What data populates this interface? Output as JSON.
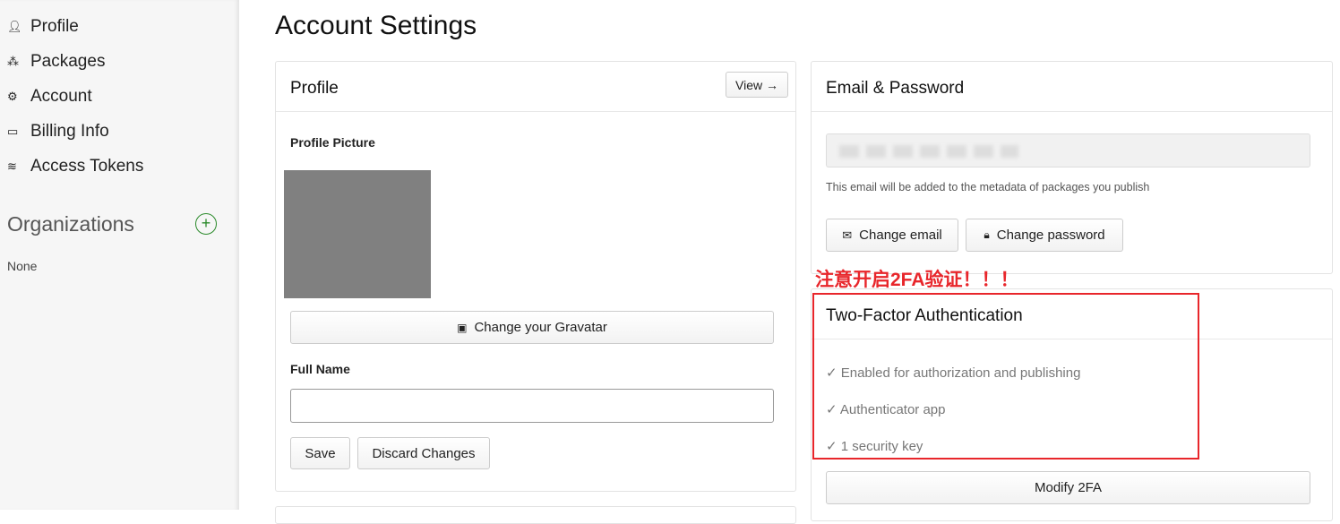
{
  "sidebar": {
    "items": [
      {
        "label": "Profile",
        "icon": "user-icon"
      },
      {
        "label": "Packages",
        "icon": "packages-icon"
      },
      {
        "label": "Account",
        "icon": "gear-icon"
      },
      {
        "label": "Billing Info",
        "icon": "credit-card-icon"
      },
      {
        "label": "Access Tokens",
        "icon": "coins-icon"
      }
    ],
    "organizations_title": "Organizations",
    "organizations_empty": "None"
  },
  "page_title": "Account Settings",
  "profile": {
    "title": "Profile",
    "view_label": "View →",
    "picture_label": "Profile Picture",
    "gravatar_button": "Change your Gravatar",
    "full_name_label": "Full Name",
    "full_name_value": "",
    "save": "Save",
    "discard": "Discard Changes"
  },
  "email": {
    "title": "Email & Password",
    "note": "This email will be added to the metadata of packages you publish",
    "change_email": "Change email",
    "change_password": "Change password"
  },
  "annotation": "注意开启2FA验证！！！",
  "tfa": {
    "title": "Two-Factor Authentication",
    "items": [
      "✓ Enabled for authorization and publishing",
      "✓ Authenticator app",
      "✓ 1 security key"
    ],
    "modify": "Modify 2FA"
  },
  "colors": {
    "annotation": "#e8262b",
    "accent_green": "#2a8a2a"
  }
}
